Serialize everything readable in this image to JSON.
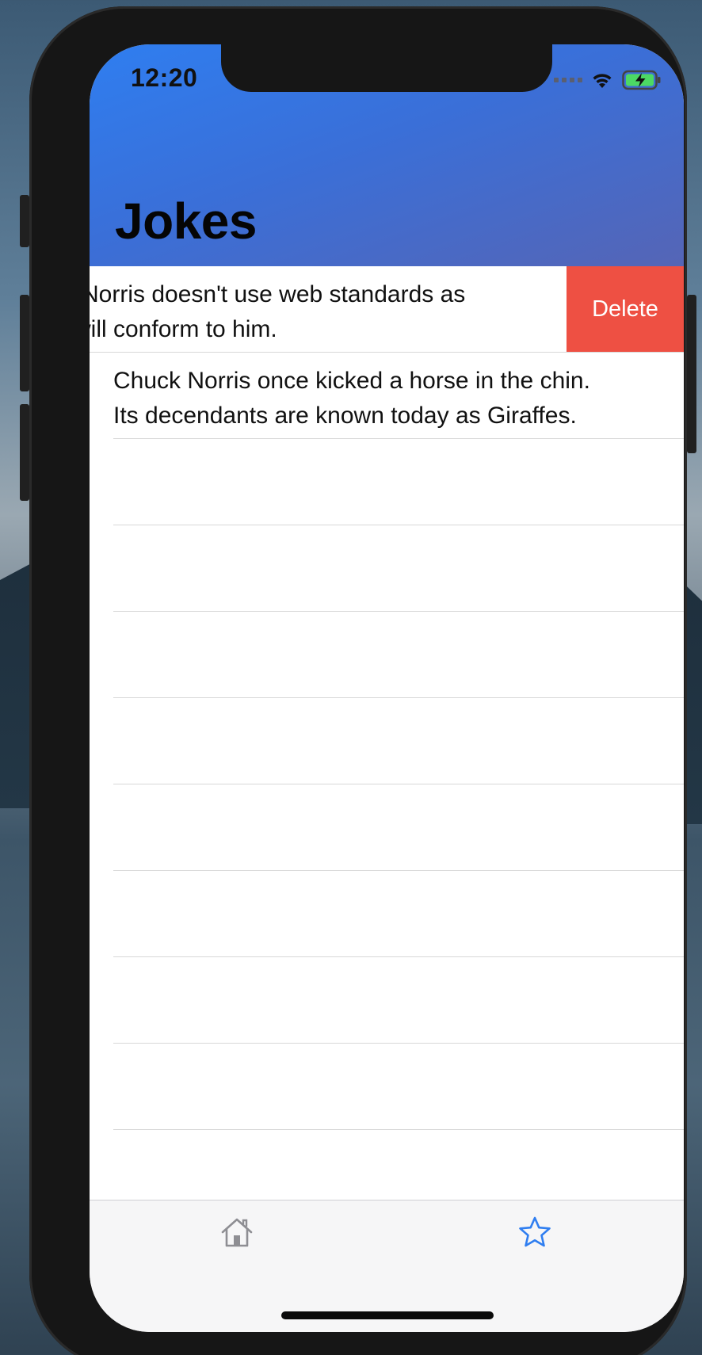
{
  "status_bar": {
    "time": "12:20"
  },
  "nav": {
    "title": "Jokes"
  },
  "jokes": [
    {
      "line1": "Norris doesn't use web standards as",
      "line2": "will conform to him.",
      "swiped": true,
      "action": "Delete"
    },
    {
      "line1": "Chuck Norris once kicked a horse in the chin.",
      "line2": "Its decendants are known today as Giraffes.",
      "swiped": false
    }
  ],
  "tab_bar": {
    "items": [
      {
        "icon": "home-icon",
        "selected": false
      },
      {
        "icon": "star-icon",
        "selected": true
      }
    ]
  },
  "colors": {
    "header_gradient_start": "#2f7ef0",
    "header_gradient_end": "#5565b6",
    "delete": "#ee5043",
    "tab_selected": "#2f7ef0",
    "tab_unselected": "#8e8e93",
    "battery": "#4cd964"
  }
}
